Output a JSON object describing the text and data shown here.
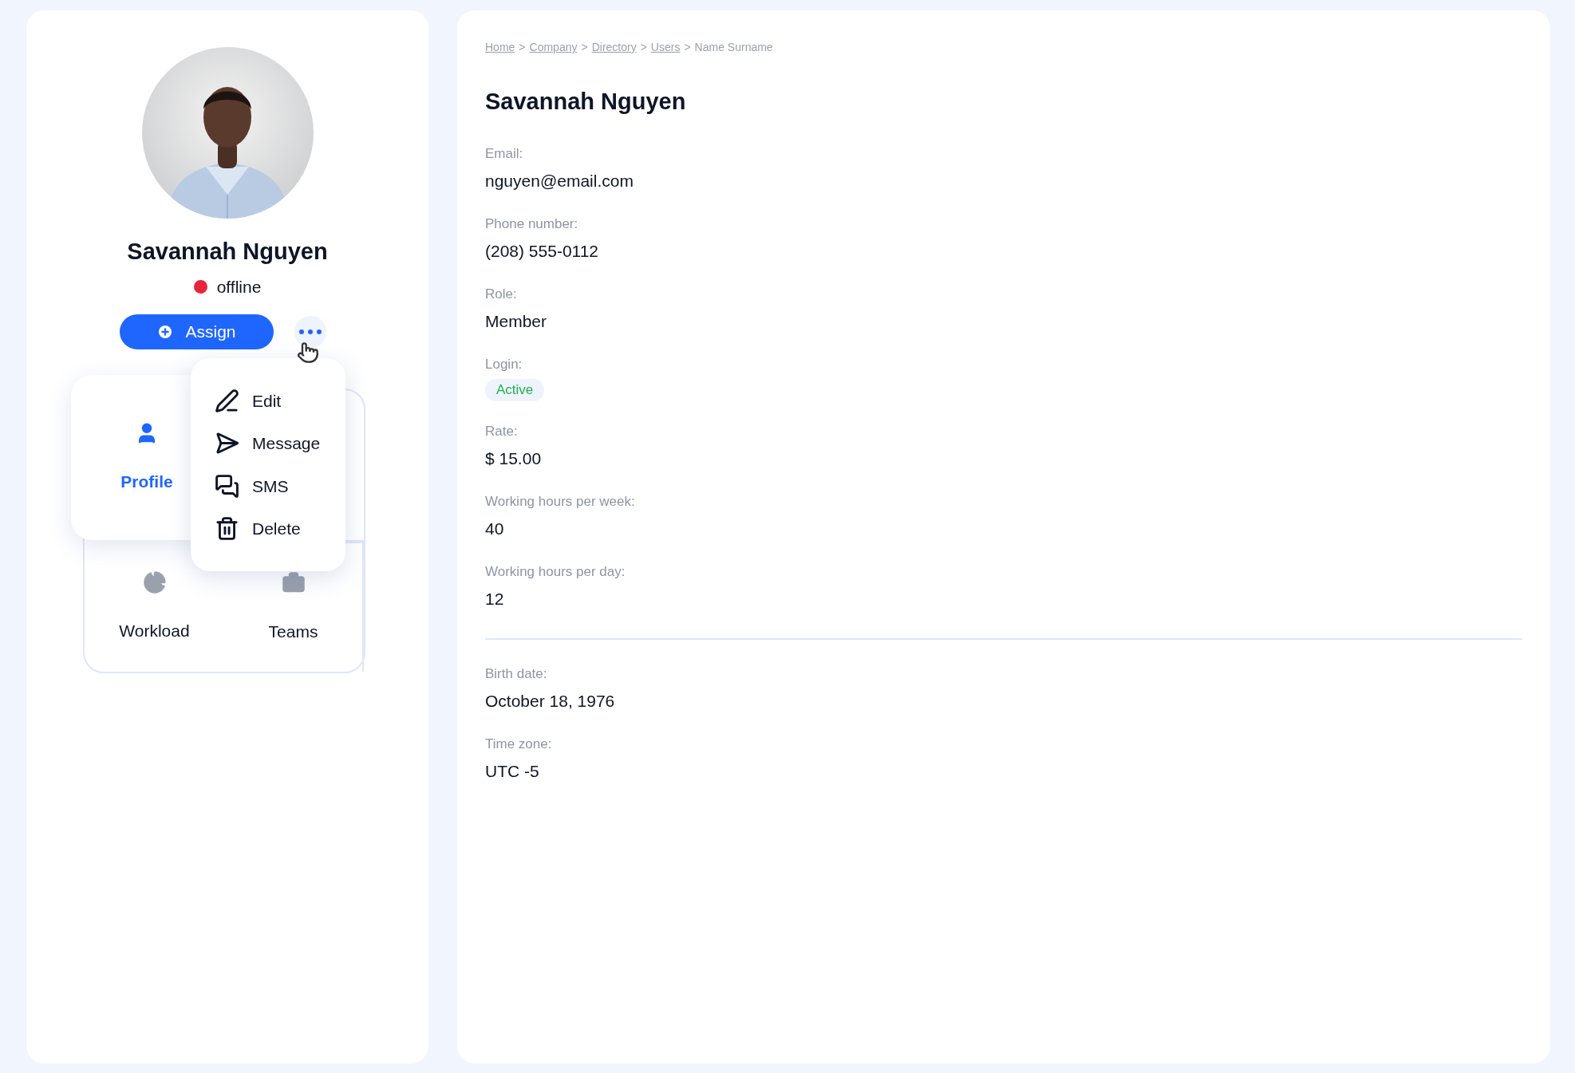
{
  "profile": {
    "name": "Savannah Nguyen",
    "status": {
      "label": "offline",
      "online": false
    },
    "assign_button": "Assign"
  },
  "menu": [
    {
      "label": "Edit",
      "kind": "edit"
    },
    {
      "label": "Message",
      "kind": "message"
    },
    {
      "label": "SMS",
      "kind": "sms"
    },
    {
      "label": "Delete",
      "kind": "delete"
    }
  ],
  "tiles": [
    {
      "label": "Profile",
      "kind": "profile",
      "selected": true
    },
    {
      "label": "Workload",
      "kind": "workload",
      "selected": false
    },
    {
      "label": "Teams",
      "kind": "teams",
      "selected": false
    }
  ],
  "breadcrumb": [
    {
      "label": "Home",
      "link": true
    },
    {
      "separator": ">",
      "label": "Company",
      "link": true
    },
    {
      "separator": ">",
      "label": "Directory",
      "link": true
    },
    {
      "separator": ">",
      "label": "Users",
      "link": true
    },
    {
      "separator": ">",
      "label": "Name Surname",
      "link": false
    }
  ],
  "title": "Savannah Nguyen",
  "sections": [
    {
      "fields": [
        {
          "label": "Email:",
          "value": "nguyen@email.com",
          "kind": "text"
        },
        {
          "label": "Phone number:",
          "value": "(208) 555-0112",
          "kind": "text"
        },
        {
          "label": "Role:",
          "value": "Member",
          "kind": "text"
        },
        {
          "label": "Login:",
          "value": "Active",
          "kind": "badge"
        },
        {
          "label": "Rate:",
          "value": "$ 15.00",
          "kind": "text"
        },
        {
          "label": "Working hours per week:",
          "value": "40",
          "kind": "text"
        },
        {
          "label": "Working hours per day:",
          "value": "12",
          "kind": "text"
        }
      ]
    },
    {
      "fields": [
        {
          "label": "Birth date:",
          "value": "October 18, 1976",
          "kind": "text"
        },
        {
          "label": "Time zone:",
          "value": "UTC -5",
          "kind": "text"
        }
      ]
    }
  ]
}
